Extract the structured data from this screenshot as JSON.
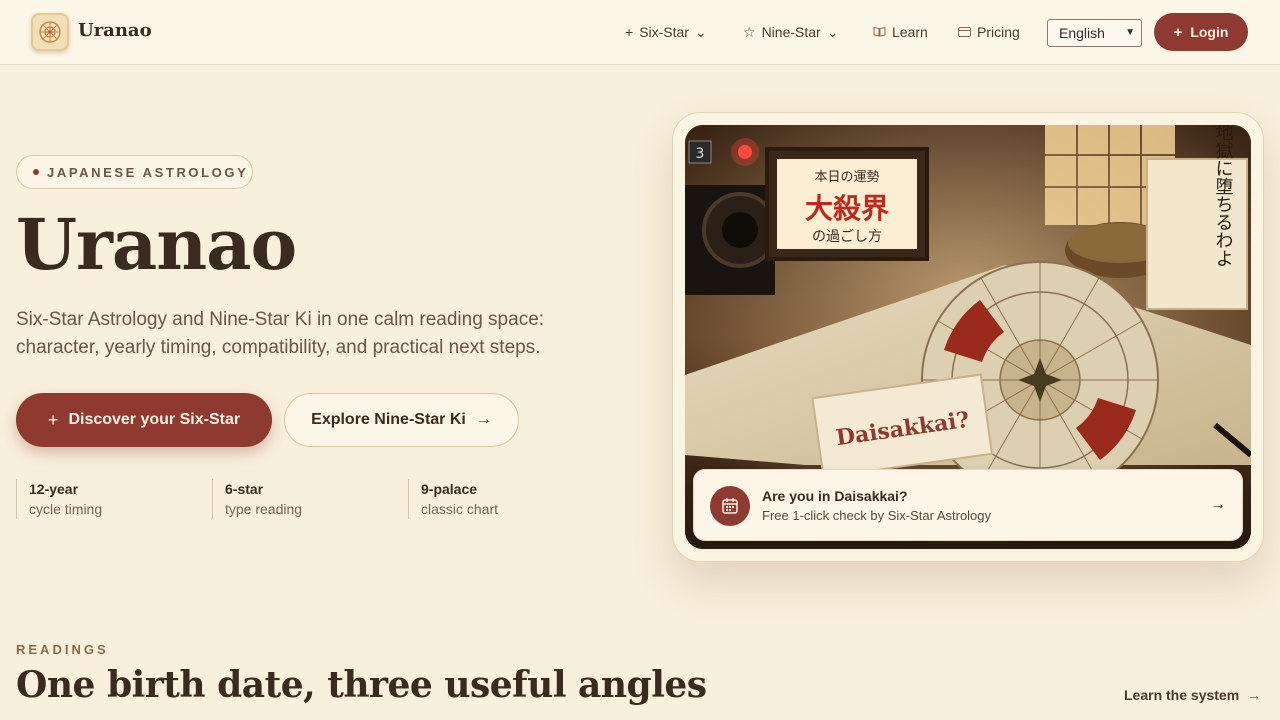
{
  "header": {
    "brand": "Uranao",
    "nav": [
      {
        "label": "Six-Star",
        "icon": "sparkle-icon",
        "has_dropdown": true
      },
      {
        "label": "Nine-Star",
        "icon": "star-icon",
        "has_dropdown": true
      },
      {
        "label": "Learn",
        "icon": "book-icon",
        "has_dropdown": false
      },
      {
        "label": "Pricing",
        "icon": "card-icon",
        "has_dropdown": false
      }
    ],
    "language": "English",
    "login_label": "Login"
  },
  "hero": {
    "badge": "JAPANESE ASTROLOGY",
    "title": "Uranao",
    "description_line1": "Six-Star Astrology and Nine-Star Ki in one calm reading space:",
    "description_line2": "character, yearly timing, compatibility, and practical next steps.",
    "primary_button": "Discover your Six-Star",
    "secondary_button": "Explore Nine-Star Ki",
    "stats": [
      {
        "value": "12-year",
        "label": "cycle timing"
      },
      {
        "value": "6-star",
        "label": "type reading"
      },
      {
        "value": "9-palace",
        "label": "classic chart"
      }
    ]
  },
  "feature_card": {
    "image_texts": {
      "sign_top": "本日の運勢",
      "sign_main": "大殺界",
      "sign_bottom": "の過ごし方",
      "card_text": "Daisakkai?",
      "scroll_text": "地獄に堕ちるわよ",
      "corner_number": "3"
    },
    "notice_title": "Are you in Daisakkai?",
    "notice_subtitle": "Free 1-click check by Six-Star Astrology"
  },
  "readings": {
    "label": "READINGS",
    "title": "One birth date, three useful angles",
    "link": "Learn the system"
  },
  "colors": {
    "accent": "#8e3a30",
    "background": "#f8efdc",
    "text": "#3b2a20"
  }
}
